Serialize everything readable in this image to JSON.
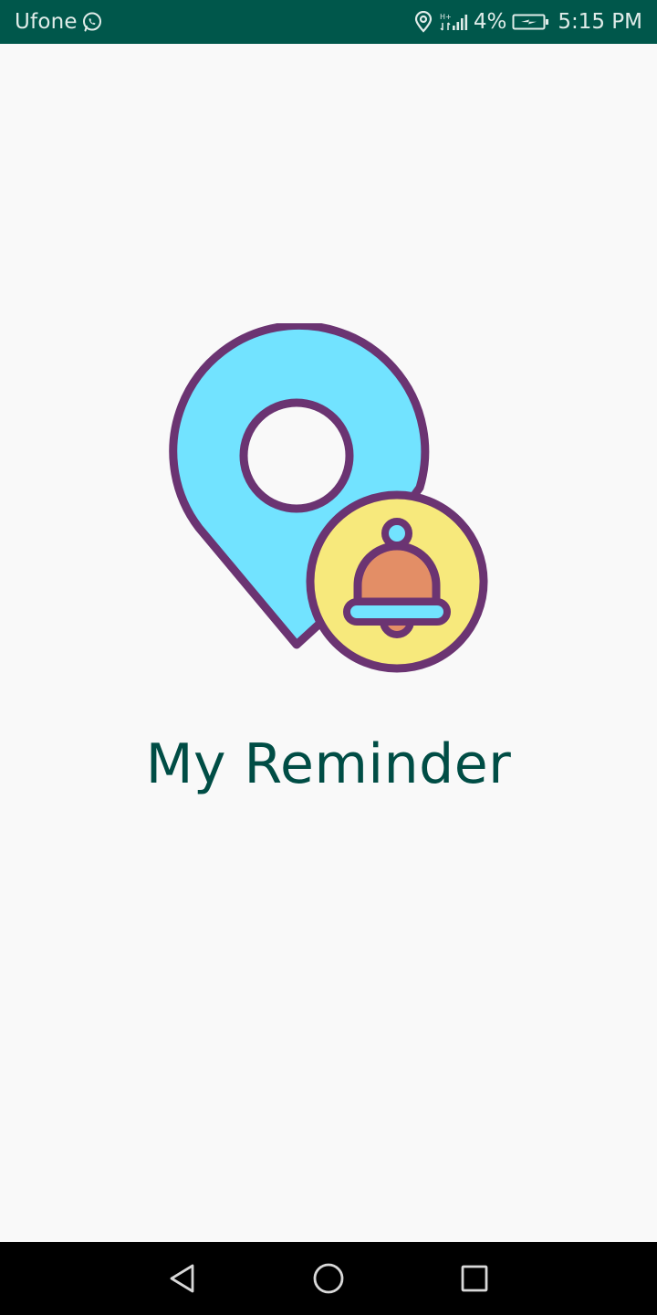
{
  "status_bar": {
    "carrier": "Ufone",
    "battery_percent": "4%",
    "time": "5:15 PM",
    "network_type": "H+",
    "icons": [
      "whatsapp-icon",
      "location-icon",
      "network-type-icon",
      "signal-icon",
      "battery-charging-icon"
    ]
  },
  "app": {
    "title": "My Reminder",
    "logo_icon": "location-pin-bell-icon"
  },
  "nav_bar": {
    "buttons": [
      "back-icon",
      "home-icon",
      "recents-icon"
    ]
  },
  "colors": {
    "status_bar_bg": "#00574b",
    "title": "#004d45",
    "background": "#f9f9f9",
    "pin_fill": "#72e3ff",
    "outline": "#6b3472",
    "bell_circle": "#f7e97c",
    "bell_body": "#e38e66"
  }
}
